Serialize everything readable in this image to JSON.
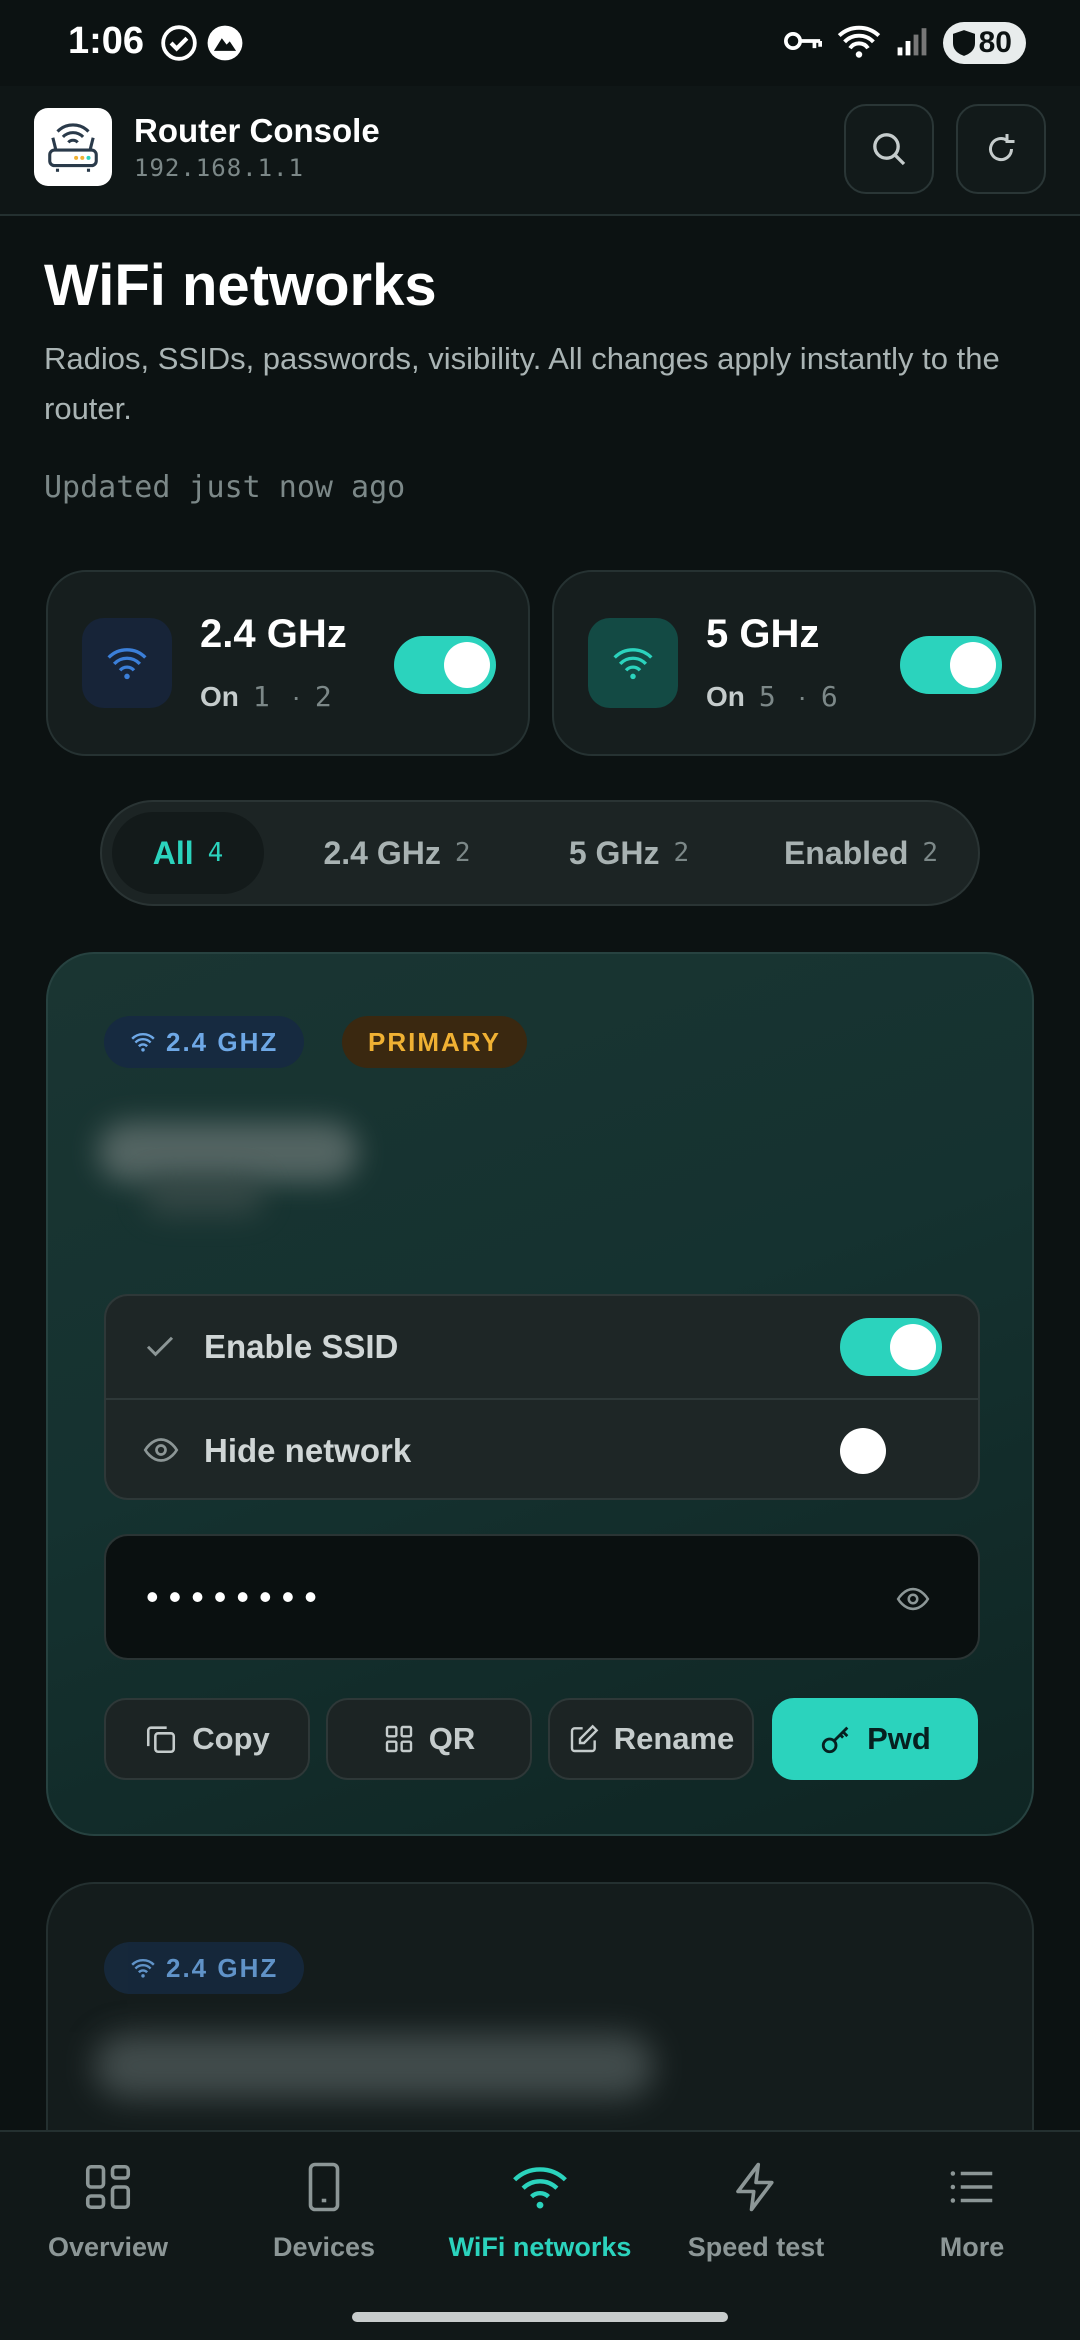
{
  "status_bar": {
    "time": "1:06",
    "battery": "80"
  },
  "app": {
    "title": "Router Console",
    "subtitle": "192.168.1.1"
  },
  "page": {
    "title": "WiFi networks",
    "description": "Radios, SSIDs, passwords, visibility. All changes apply instantly to the router.",
    "updated": "Updated just now ago"
  },
  "radios": [
    {
      "name": "2.4 GHz",
      "state": "On",
      "ch_a": "1",
      "sep": "·",
      "ch_b": "2",
      "enabled": true,
      "accent": "#3b7fd9"
    },
    {
      "name": "5 GHz",
      "state": "On",
      "ch_a": "5",
      "sep": "·",
      "ch_b": "6",
      "enabled": true,
      "accent": "#2bd3bd"
    }
  ],
  "filters": [
    {
      "label": "All",
      "count": "4",
      "active": true
    },
    {
      "label": "2.4 GHz",
      "count": "2",
      "active": false
    },
    {
      "label": "5 GHz",
      "count": "2",
      "active": false
    },
    {
      "label": "Enabled",
      "count": "2",
      "active": false
    }
  ],
  "network_card": {
    "band_badge": "2.4 GHZ",
    "primary_badge": "PRIMARY",
    "enable_label": "Enable SSID",
    "enable_on": true,
    "hide_label": "Hide network",
    "hide_on": false,
    "password_mask": "••••••••",
    "actions": {
      "copy": "Copy",
      "qr": "QR",
      "rename": "Rename",
      "pwd": "Pwd"
    }
  },
  "network_card_2": {
    "band_badge": "2.4 GHZ"
  },
  "nav": [
    {
      "label": "Overview",
      "icon": "grid-icon",
      "active": false
    },
    {
      "label": "Devices",
      "icon": "phone-icon",
      "active": false
    },
    {
      "label": "WiFi networks",
      "icon": "wifi-icon",
      "active": true
    },
    {
      "label": "Speed test",
      "icon": "bolt-icon",
      "active": false
    },
    {
      "label": "More",
      "icon": "list-icon",
      "active": false
    }
  ],
  "colors": {
    "accent": "#2bd3bd",
    "background": "#0c1212",
    "warning": "#f0b133",
    "band_blue": "#6ea8e6"
  }
}
